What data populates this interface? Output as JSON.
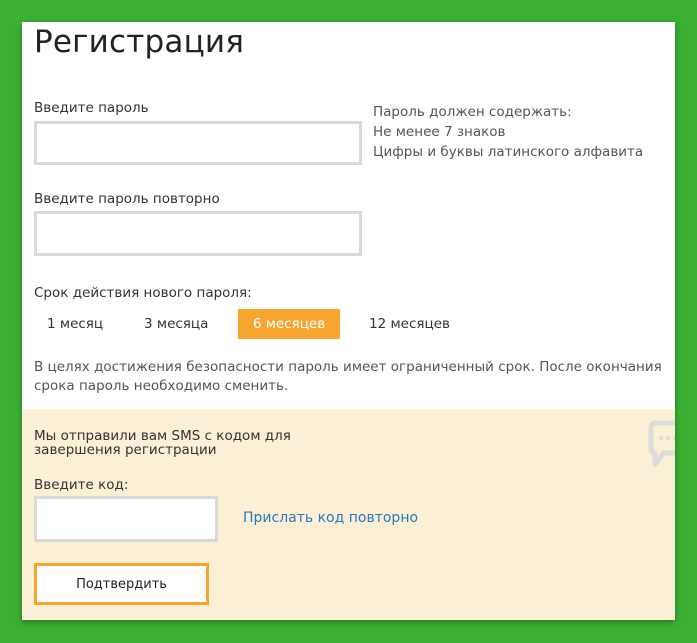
{
  "page": {
    "title": "Регистрация"
  },
  "password": {
    "label": "Введите пароль",
    "value": "",
    "repeat_label": "Введите пароль повторно",
    "repeat_value": ""
  },
  "requirements": {
    "heading": "Пароль должен содержать:",
    "items": [
      "Не менее 7 знаков",
      "Цифры и буквы латинского алфавита"
    ]
  },
  "validity": {
    "label": "Срок действия нового пароля:",
    "options": [
      "1 месяц",
      "3 месяца",
      "6 месяцев",
      "12 месяцев"
    ],
    "selected": "6 месяцев",
    "notice": "В целях достижения безопасности пароль имеет ограниченный срок. После окончания срока пароль необходимо сменить."
  },
  "sms": {
    "message_line1": "Мы отправили вам SMS с кодом для",
    "message_line2": "завершения регистрации",
    "code_label": "Введите код:",
    "code_value": "",
    "resend_label": "Прислать код повторно",
    "icon": "speech-bubble-icon"
  },
  "actions": {
    "confirm_label": "Подтвердить"
  },
  "colors": {
    "background": "#3cb035",
    "accent": "#f6a531",
    "sms_panel": "#fbf0d6",
    "link": "#2a7ab8"
  }
}
